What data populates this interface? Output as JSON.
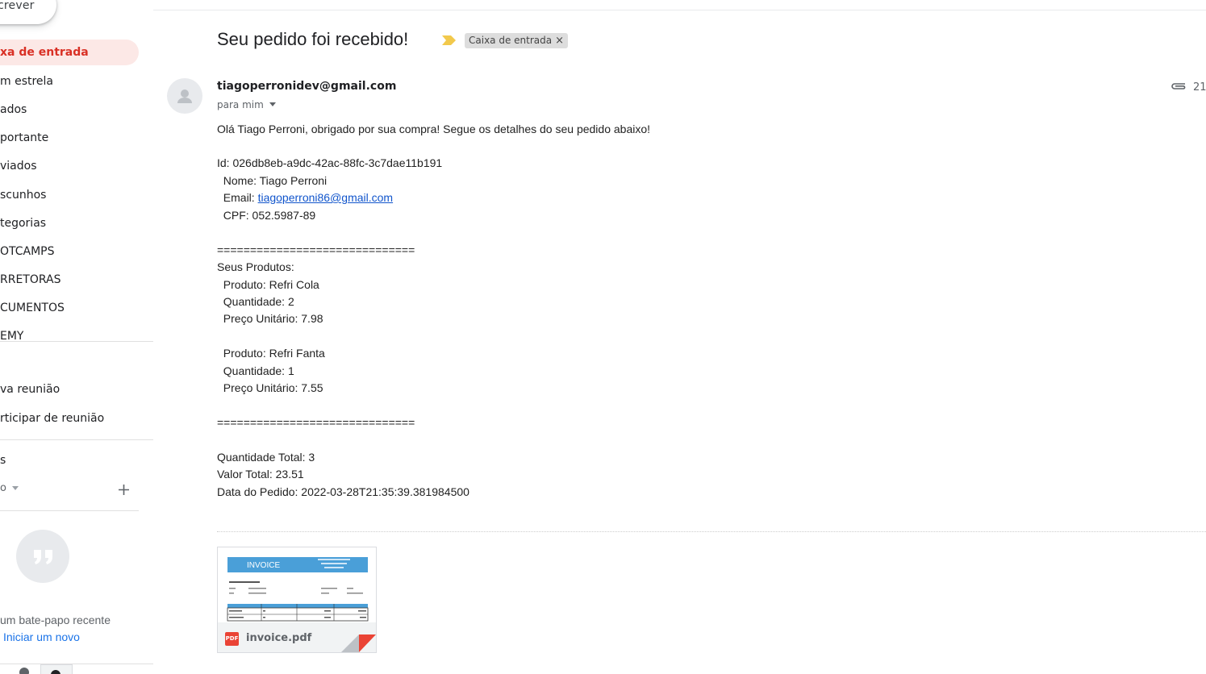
{
  "sidebar": {
    "compose_label": "crever",
    "items": [
      {
        "label": "xa de entrada",
        "active": true
      },
      {
        "label": "m estrela"
      },
      {
        "label": "ados"
      },
      {
        "label": "portante"
      },
      {
        "label": "viados"
      },
      {
        "label": "scunhos"
      },
      {
        "label": "tegorias"
      },
      {
        "label": "OTCAMPS"
      },
      {
        "label": "RRETORAS"
      },
      {
        "label": "CUMENTOS"
      },
      {
        "label": "EMY"
      }
    ],
    "meet": {
      "new_meeting": "va reunião",
      "join_meeting": "rticipar de reunião"
    },
    "hangouts": {
      "section_letter": "s",
      "user_letter": "o",
      "add_icon": "plus-icon",
      "empty_text": "um bate-papo recente",
      "start_link": "Iniciar um novo"
    }
  },
  "message": {
    "subject": "Seu pedido foi recebido!",
    "label_chip": "Caixa de entrada",
    "label_remove": "×",
    "sender": "tiagoperronidev@gmail.com",
    "to_line": "para mim",
    "date_partial": "21",
    "body_lines": [
      "Olá Tiago Perroni, obrigado por sua compra! Segue os detalhes do seu pedido abaixo!",
      "Id: 026db8eb-a9dc-42ac-88fc-3c7dae11b191",
      "  Nome: Tiago Perroni",
      "  Email: ",
      "  CPF: 052.5987-89",
      "==============================",
      "Seus Produtos:",
      "  Produto: Refri Cola",
      "  Quantidade: 2",
      "  Preço Unitário: 7.98",
      "  Produto: Refri Fanta",
      "  Quantidade: 1",
      "  Preço Unitário: 7.55",
      "==============================",
      "Quantidade Total: 3",
      "Valor Total: 23.51",
      "Data do Pedido: 2022-03-28T21:35:39.381984500"
    ],
    "email_link": "tiagoperroni86@gmail.com"
  },
  "attachment": {
    "name": "invoice.pdf",
    "type_badge": "PDF",
    "thumb_title": "INVOICE"
  },
  "colors": {
    "active_bg": "#fce8e6",
    "active_text": "#d93025",
    "link": "#1155cc",
    "important_marker": "#f2c94c"
  }
}
